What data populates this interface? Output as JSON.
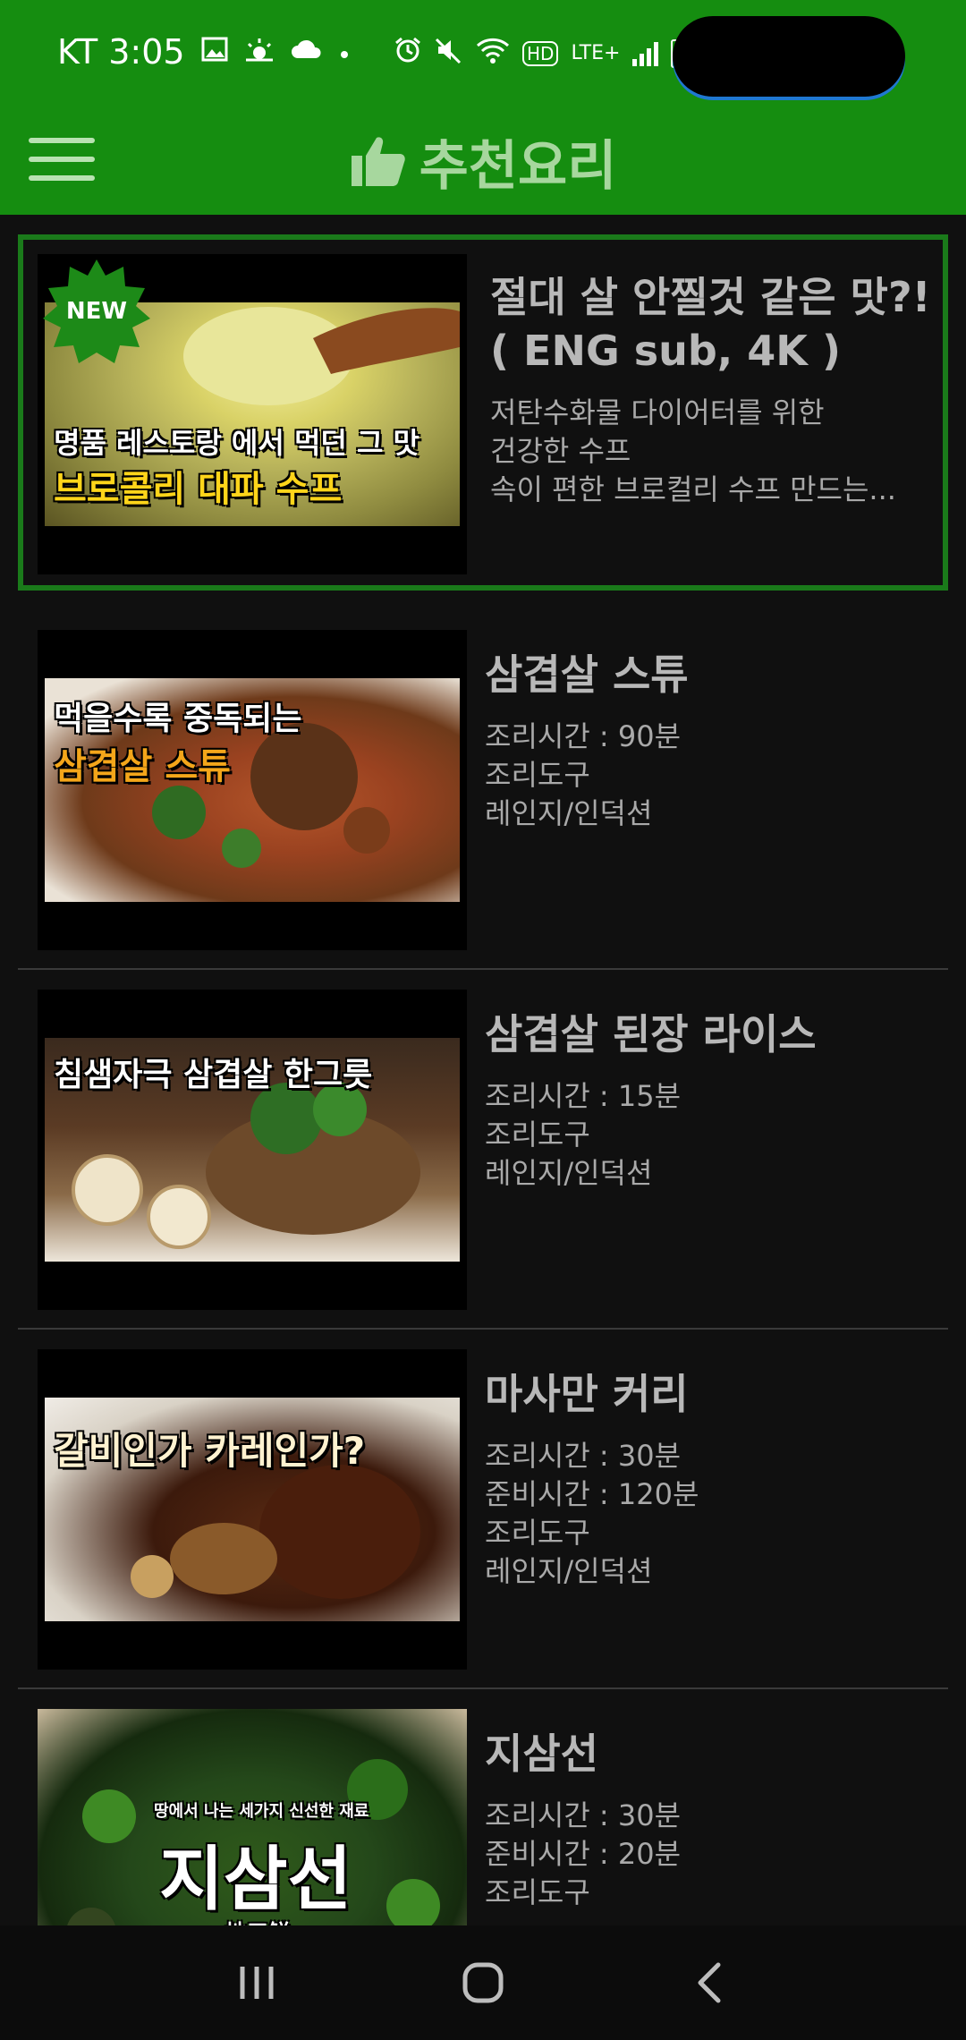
{
  "status_bar": {
    "carrier_time": "KT 3:05",
    "network_label": "LTE+",
    "hd_label": "HD"
  },
  "app_bar": {
    "title": "추천요리",
    "menu_icon": "hamburger-menu-icon",
    "title_icon": "thumbs-up-icon",
    "accent_color": "#158d10"
  },
  "recipes": [
    {
      "title": "절대 살 안찔것 같은 맛?!( ENG sub, 4K )",
      "lines": [
        "저탄수화물 다이어터를 위한",
        "건강한 수프",
        "속이 편한 브로컬리 수프 만드는..."
      ],
      "thumb_caption_top": "명품 레스토랑 에서 먹던 그 맛",
      "thumb_caption_bottom": "브로콜리 대파 수프",
      "badge": "NEW",
      "selected": true
    },
    {
      "title": "삼겹살 스튜",
      "lines": [
        "조리시간 : 90분",
        "조리도구",
        "레인지/인덕션"
      ],
      "thumb_caption_top": "먹을수록 중독되는",
      "thumb_caption_bottom": "삼겹살 스튜"
    },
    {
      "title": "삼겹살 된장 라이스",
      "lines": [
        "조리시간 : 15분",
        "조리도구",
        "레인지/인덕션"
      ],
      "thumb_caption_top": "침샘자극 삼겹살 한그릇",
      "thumb_caption_bottom": ""
    },
    {
      "title": "마사만 커리",
      "lines": [
        "조리시간 : 30분",
        "준비시간 : 120분",
        "조리도구",
        "레인지/인덕션"
      ],
      "thumb_caption_top": "갈비인가 카레인가?",
      "thumb_caption_bottom": ""
    },
    {
      "title": "지삼선",
      "lines": [
        "조리시간 : 30분",
        "준비시간 : 20분",
        "조리도구"
      ],
      "thumb_caption_top": "땅에서 나는 세가지 신선한 재료",
      "thumb_caption_bottom": "지삼선",
      "thumb_caption_sub": "地三鮮"
    }
  ],
  "nav_bar": {
    "recents_icon": "recents-icon",
    "home_icon": "home-icon",
    "back_icon": "back-icon"
  }
}
